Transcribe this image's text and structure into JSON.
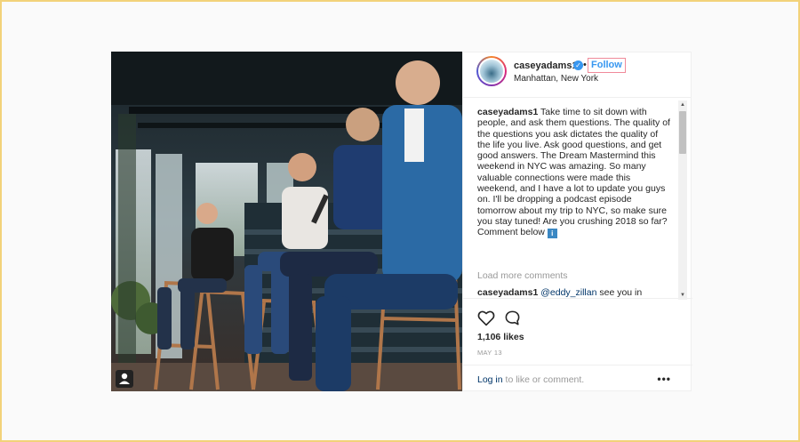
{
  "post": {
    "username": "caseyadams1",
    "follow_label": "Follow",
    "dot": "•",
    "location": "Manhattan, New York"
  },
  "caption": {
    "username": "caseyadams1",
    "text": "Take time to sit down with people, and ask them questions. The quality of the questions you ask dictates the quality of the life you live. Ask good questions, and get good answers. The Dream Mastermind this weekend in NYC was amazing. So many valuable connections were made this weekend, and I have a lot to update you guys on. I'll be dropping a podcast episode tomorrow about my trip to NYC, so make sure you stay tuned! Are you crushing 2018 so far? Comment below",
    "emoji": "i"
  },
  "load_more_label": "Load more comments",
  "comment": {
    "username": "caseyadams1",
    "mention": "@eddy_zillan",
    "text": "see you in August 😉"
  },
  "likes_label": "1,106 likes",
  "date_label": "MAY 13",
  "footer": {
    "login_label": "Log in",
    "suffix": " to like or comment.",
    "more_label": "•••"
  },
  "icons": {
    "verified": "verified-badge-icon",
    "heart": "heart-icon",
    "comment": "comment-icon",
    "user_tag": "user-tag-icon",
    "more": "more-options-icon"
  },
  "colors": {
    "link_blue": "#3897f0",
    "text": "#262626",
    "muted": "#999999",
    "frame": "#f2d27a"
  }
}
